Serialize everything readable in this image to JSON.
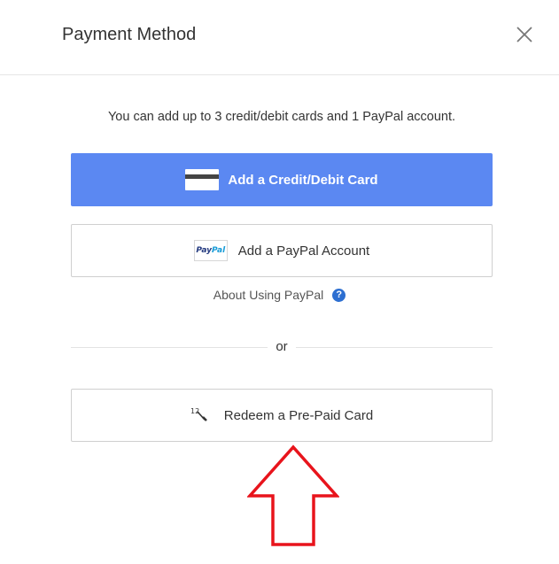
{
  "dialog": {
    "title": "Payment Method"
  },
  "info_text": "You can add up to 3 credit/debit cards and 1 PayPal account.",
  "buttons": {
    "credit_card": "Add a Credit/Debit Card",
    "paypal": "Add a PayPal Account",
    "redeem": "Redeem a Pre-Paid Card"
  },
  "paypal_logo": {
    "part1": "Pay",
    "part2": "Pal"
  },
  "about_paypal": "About Using PayPal",
  "help_icon_glyph": "?",
  "redeem_icon_glyph": "¹²⁄₃",
  "separator_text": "or",
  "icons": {
    "close": "close-icon",
    "card": "credit-card-icon",
    "paypal": "paypal-logo-icon",
    "help": "help-icon",
    "redeem": "redeem-code-icon",
    "annotation": "red-arrow-annotation"
  },
  "colors": {
    "primary_button": "#5b88f2",
    "help_icon": "#2d6fd1",
    "annotation_arrow": "#e8141c"
  }
}
